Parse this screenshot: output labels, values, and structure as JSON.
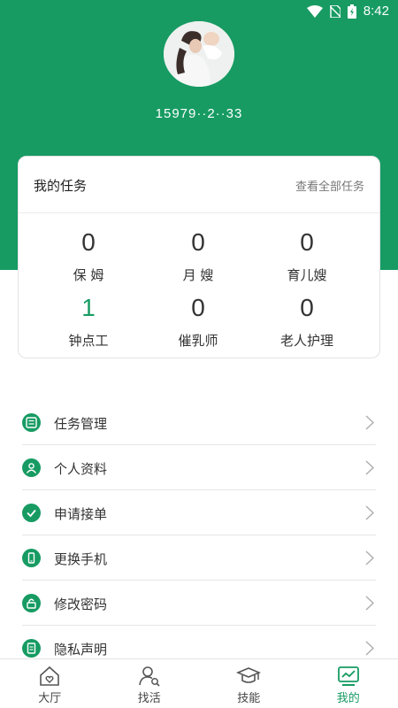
{
  "status_bar": {
    "time": "8:42"
  },
  "profile": {
    "phone": "15979··2··33"
  },
  "task_card": {
    "title": "我的任务",
    "view_all": "查看全部任务",
    "items": [
      {
        "count": "0",
        "label": "保 姆"
      },
      {
        "count": "0",
        "label": "月 嫂"
      },
      {
        "count": "0",
        "label": "育儿嫂"
      },
      {
        "count": "1",
        "label": "钟点工"
      },
      {
        "count": "0",
        "label": "催乳师"
      },
      {
        "count": "0",
        "label": "老人护理"
      }
    ]
  },
  "menu": [
    {
      "label": "任务管理",
      "icon": "list-icon"
    },
    {
      "label": "个人资料",
      "icon": "user-icon"
    },
    {
      "label": "申请接单",
      "icon": "check-icon"
    },
    {
      "label": "更换手机",
      "icon": "phone-icon"
    },
    {
      "label": "修改密码",
      "icon": "lock-icon"
    },
    {
      "label": "隐私声明",
      "icon": "document-icon"
    }
  ],
  "tabs": [
    {
      "label": "大厅",
      "icon": "home-heart-icon"
    },
    {
      "label": "找活",
      "icon": "person-search-icon"
    },
    {
      "label": "技能",
      "icon": "graduation-cap-icon"
    },
    {
      "label": "我的",
      "icon": "chart-monitor-icon"
    }
  ],
  "colors": {
    "accent": "#179b63",
    "text": "#333333",
    "muted": "#777777"
  }
}
